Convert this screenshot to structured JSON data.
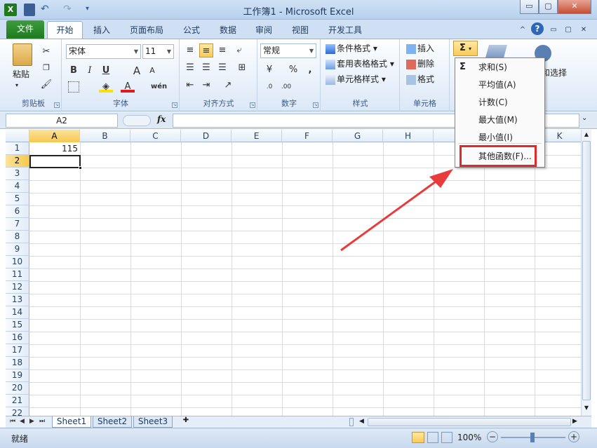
{
  "window": {
    "title": "工作簿1 - Microsoft Excel",
    "min": "▭",
    "max": "▢",
    "close": "✕"
  },
  "tabs": {
    "file": "文件",
    "home": "开始",
    "insert": "插入",
    "layout": "页面布局",
    "formulas": "公式",
    "data": "数据",
    "review": "审阅",
    "view": "视图",
    "developer": "开发工具"
  },
  "ribbon": {
    "clipboard": {
      "label": "剪贴板",
      "paste": "粘贴"
    },
    "font": {
      "label": "字体",
      "name": "宋体",
      "size": "11",
      "bold": "B",
      "italic": "I",
      "underline": "U",
      "grow": "A",
      "shrink": "A",
      "fontcolor": "A",
      "wen": "wén"
    },
    "align": {
      "label": "对齐方式"
    },
    "number": {
      "label": "数字",
      "format": "常规",
      "percent": "%",
      "comma": ","
    },
    "styles": {
      "label": "样式",
      "conditional": "条件格式",
      "table": "套用表格格式",
      "cell": "单元格样式"
    },
    "cells": {
      "label": "单元格",
      "insert": "插入",
      "delete": "删除",
      "format": "格式"
    },
    "editing": {
      "sum": "Σ",
      "select": "和选择"
    }
  },
  "formula_bar": {
    "name_box": "A2",
    "fx": "fx"
  },
  "grid": {
    "columns": [
      "A",
      "B",
      "C",
      "D",
      "E",
      "F",
      "G",
      "H",
      "I",
      "J",
      "K"
    ],
    "rows": [
      "1",
      "2",
      "3",
      "4",
      "5",
      "6",
      "7",
      "8",
      "9",
      "10",
      "11",
      "12",
      "13",
      "14",
      "15",
      "16",
      "17",
      "18",
      "19",
      "20",
      "21",
      "22"
    ],
    "a1_value": "115",
    "selected_cell": "A2"
  },
  "dropdown": {
    "items": [
      "求和(S)",
      "平均值(A)",
      "计数(C)",
      "最大值(M)",
      "最小值(I)",
      "其他函数(F)..."
    ],
    "sigma": "Σ"
  },
  "sheets": [
    "Sheet1",
    "Sheet2",
    "Sheet3"
  ],
  "status": {
    "ready": "就绪",
    "zoom": "100%",
    "minus": "−",
    "plus": "+"
  },
  "colors": {
    "accent": "#1f7a1f",
    "highlight": "#e02a2a",
    "selection": "#f6c94e"
  }
}
